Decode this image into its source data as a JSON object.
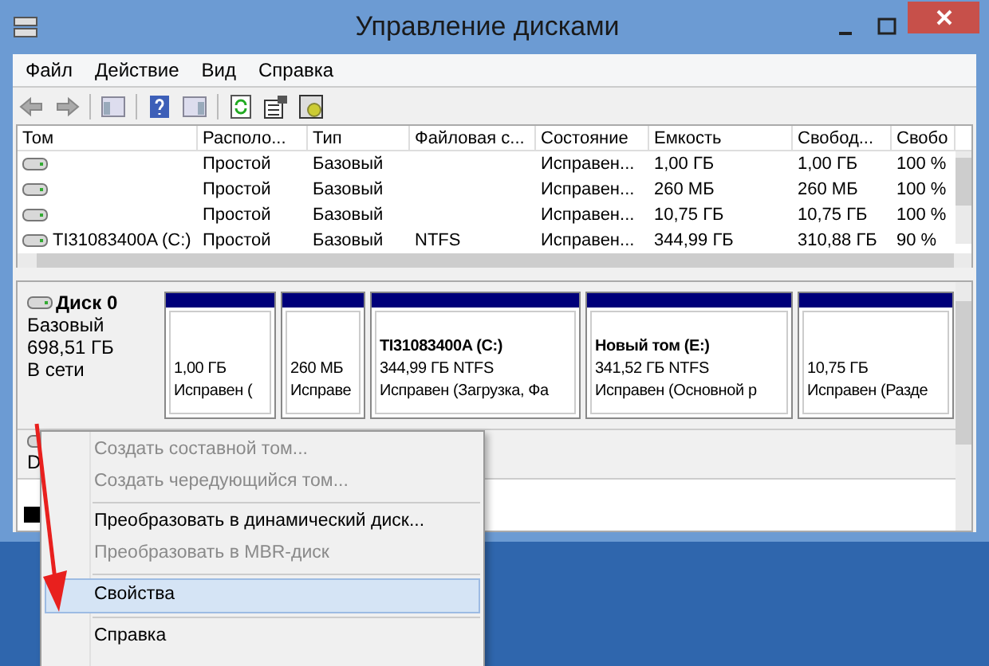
{
  "window": {
    "title": "Управление дисками"
  },
  "menu": [
    "Файл",
    "Действие",
    "Вид",
    "Справка"
  ],
  "table": {
    "columns": [
      "Том",
      "Располо...",
      "Тип",
      "Файловая с...",
      "Состояние",
      "Емкость",
      "Свобод...",
      "Свобо"
    ],
    "rows": [
      {
        "cells": [
          "",
          "Простой",
          "Базовый",
          "",
          "Исправен...",
          "1,00 ГБ",
          "1,00 ГБ",
          "100 %"
        ]
      },
      {
        "cells": [
          "",
          "Простой",
          "Базовый",
          "",
          "Исправен...",
          "260 МБ",
          "260 МБ",
          "100 %"
        ]
      },
      {
        "cells": [
          "",
          "Простой",
          "Базовый",
          "",
          "Исправен...",
          "10,75 ГБ",
          "10,75 ГБ",
          "100 %"
        ]
      },
      {
        "cells": [
          "TI31083400A (C:)",
          "Простой",
          "Базовый",
          "NTFS",
          "Исправен...",
          "344,99 ГБ",
          "310,88 ГБ",
          "90 %"
        ]
      }
    ]
  },
  "disks": [
    {
      "name": "Диск 0",
      "type": "Базовый",
      "size": "698,51 ГБ",
      "status": "В сети",
      "partitions": [
        {
          "size": "1,00 ГБ",
          "status": "Исправен ("
        },
        {
          "size": "260 МБ",
          "status": "Исправе"
        },
        {
          "label": "TI31083400A  (C:)",
          "size": "344,99 ГБ NTFS",
          "status": "Исправен (Загрузка, Фа"
        },
        {
          "label": "Новый том  (E:)",
          "size": "341,52 ГБ NTFS",
          "status": "Исправен (Основной р"
        },
        {
          "size": "10,75 ГБ",
          "status": "Исправен (Разде"
        }
      ]
    },
    {
      "name": "D"
    }
  ],
  "context_menu": [
    {
      "kind": "item",
      "label": "Создать составной том...",
      "disabled": true,
      "selected": false
    },
    {
      "kind": "item",
      "label": "Создать чередующийся том...",
      "disabled": true,
      "selected": false
    },
    {
      "kind": "separator"
    },
    {
      "kind": "item",
      "label": "Преобразовать в динамический диск...",
      "disabled": false,
      "selected": false
    },
    {
      "kind": "item",
      "label": "Преобразовать в MBR-диск",
      "disabled": true,
      "selected": false
    },
    {
      "kind": "separator"
    },
    {
      "kind": "item",
      "label": "Свойства",
      "disabled": false,
      "selected": true
    },
    {
      "kind": "separator"
    },
    {
      "kind": "item",
      "label": "Справка",
      "disabled": false,
      "selected": false
    }
  ]
}
